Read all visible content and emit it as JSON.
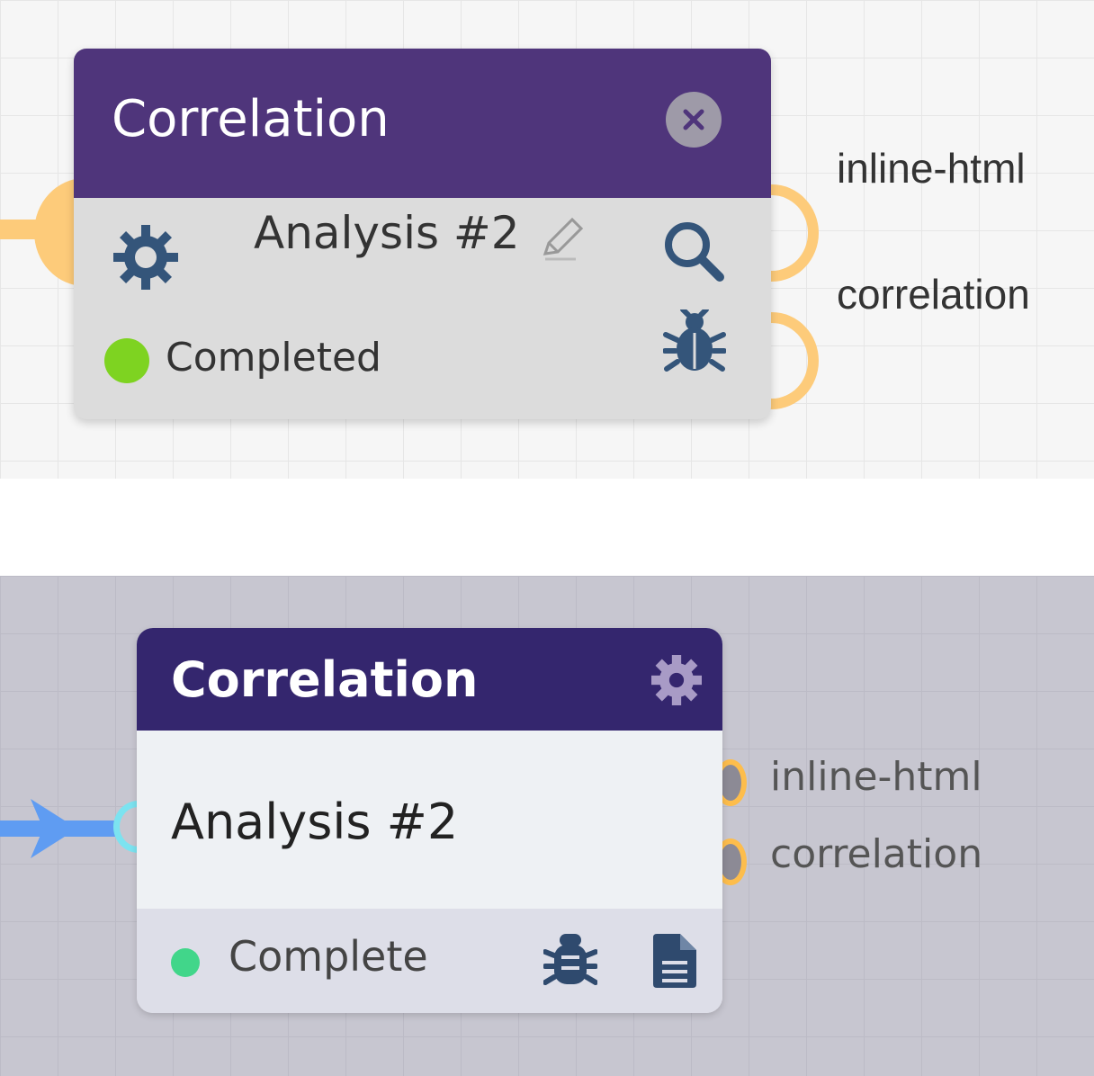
{
  "top_node": {
    "title": "Correlation",
    "name": "Analysis #2",
    "status": "Completed",
    "outputs": [
      "inline-html",
      "correlation"
    ],
    "colors": {
      "header": "#4f357b",
      "body": "#dcdcdc",
      "port": "#fdcb7a",
      "status_dot": "#7ed321"
    }
  },
  "bottom_node": {
    "title": "Correlation",
    "name": "Analysis #2",
    "status": "Complete",
    "outputs": [
      "inline-html",
      "correlation"
    ],
    "colors": {
      "header": "#34266e",
      "body": "#eef1f4",
      "footer": "#dddee8",
      "port": "#fdbd4c",
      "status_dot": "#41d68a",
      "input_wire": "#5f9cf2"
    }
  }
}
